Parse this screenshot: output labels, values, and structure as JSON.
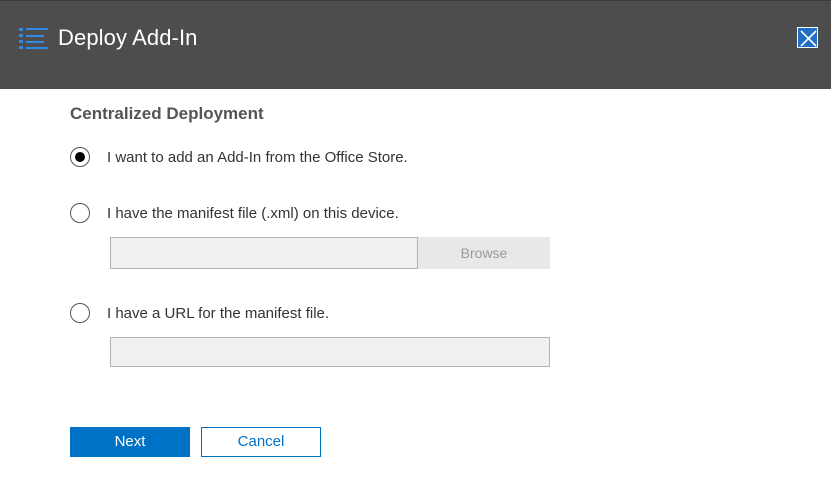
{
  "window": {
    "title": "Deploy Add-In",
    "app_icon": "list-icon",
    "close_icon": "close-icon"
  },
  "form": {
    "section_title": "Centralized Deployment",
    "options": [
      {
        "label": "I want to add an Add-In from the Office Store.",
        "selected": true
      },
      {
        "label": "I have the manifest file (.xml) on this device.",
        "selected": false
      },
      {
        "label": "I have a URL for the manifest file.",
        "selected": false
      }
    ],
    "file_path": {
      "value": "",
      "placeholder": ""
    },
    "browse_label": "Browse",
    "url": {
      "value": "",
      "placeholder": ""
    }
  },
  "actions": {
    "next_label": "Next",
    "cancel_label": "Cancel"
  },
  "colors": {
    "titlebar": "#4d4d4d",
    "accent": "#0072c6"
  }
}
